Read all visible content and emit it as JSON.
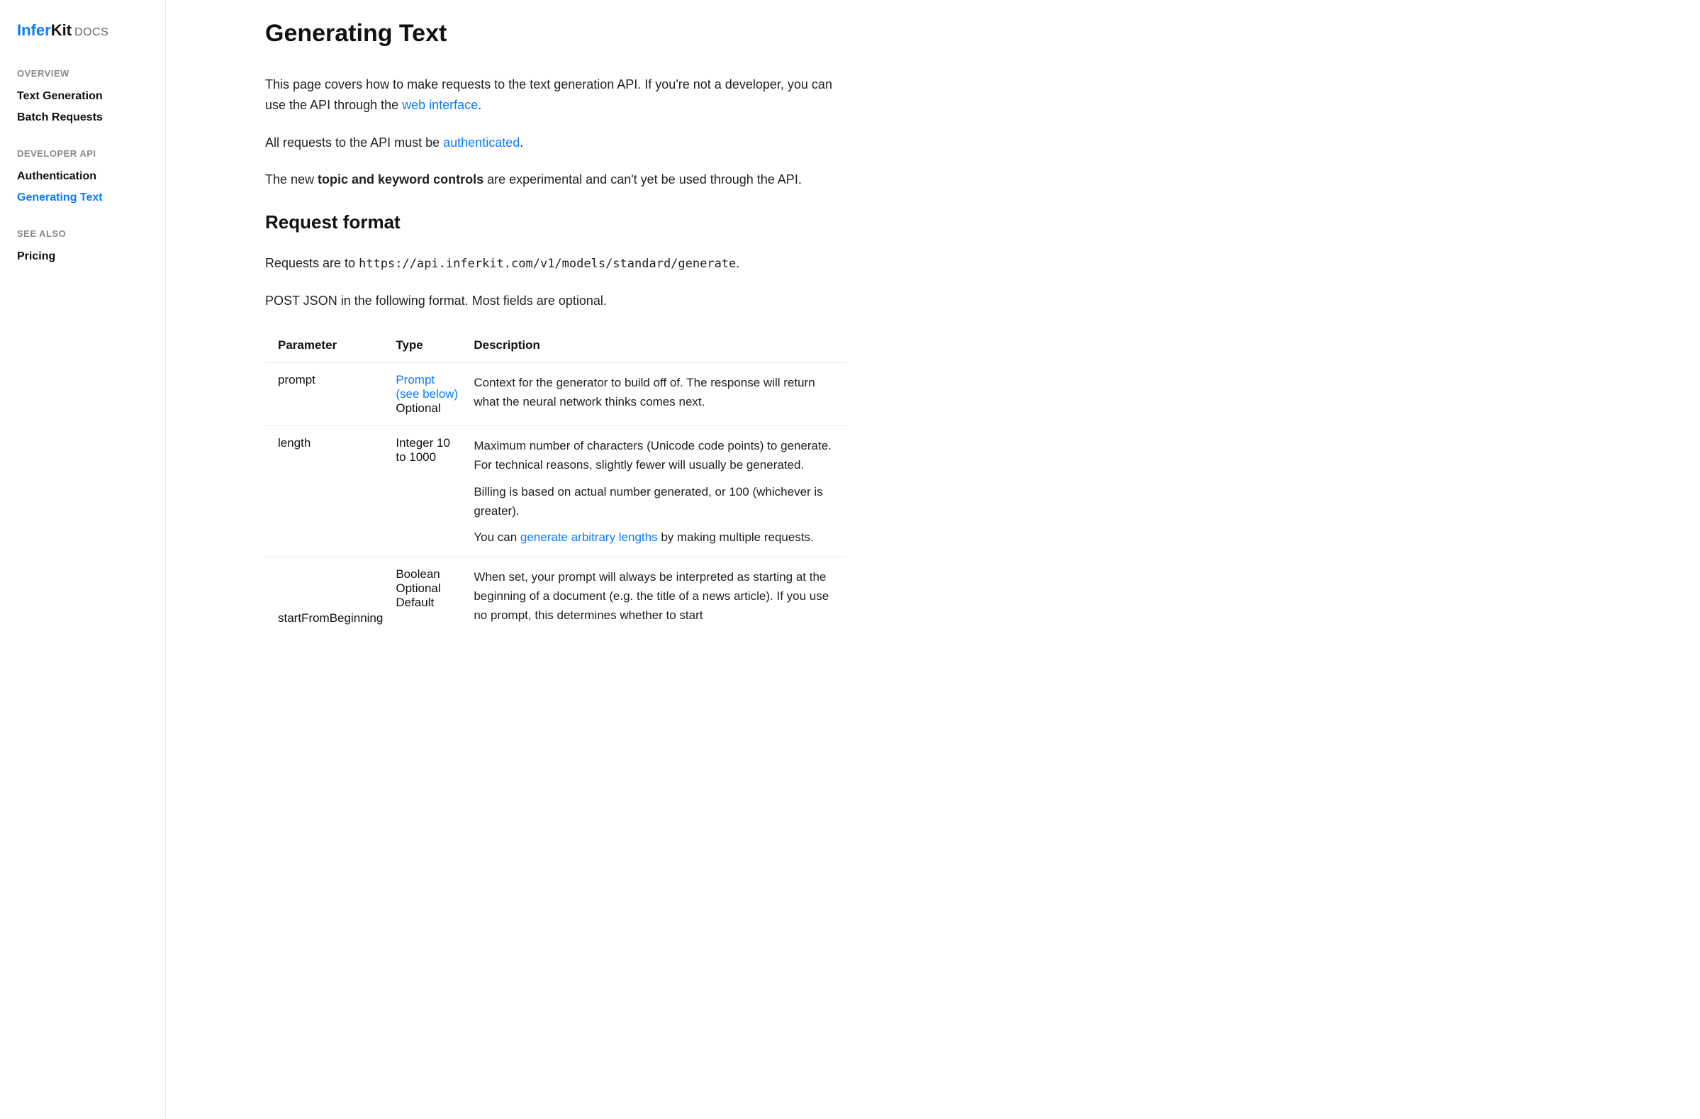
{
  "logo": {
    "part1": "Infer",
    "part2": "Kit",
    "suffix": "DOCS"
  },
  "sidebar": {
    "sections": [
      {
        "header": "OVERVIEW",
        "items": [
          {
            "label": "Text Generation",
            "active": false
          },
          {
            "label": "Batch Requests",
            "active": false
          }
        ]
      },
      {
        "header": "DEVELOPER API",
        "items": [
          {
            "label": "Authentication",
            "active": false
          },
          {
            "label": "Generating Text",
            "active": true
          }
        ]
      },
      {
        "header": "SEE ALSO",
        "items": [
          {
            "label": "Pricing",
            "active": false
          }
        ]
      }
    ]
  },
  "content": {
    "title": "Generating Text",
    "intro1_a": "This page covers how to make requests to the text generation API. If you're not a developer, you can use the API through the ",
    "intro1_link": "web interface",
    "intro1_b": ".",
    "intro2_a": "All requests to the API must be ",
    "intro2_link": "authenticated",
    "intro2_b": ".",
    "intro3_a": "The new ",
    "intro3_strong": "topic and keyword controls",
    "intro3_b": " are experimental and can't yet be used through the API.",
    "h2_request_format": "Request format",
    "requests_to_a": "Requests are to ",
    "requests_to_code": "https://api.inferkit.com/v1/models/standard/generate",
    "requests_to_b": ".",
    "post_json": "POST JSON in the following format. Most fields are optional.",
    "table": {
      "headers": {
        "param": "Parameter",
        "type": "Type",
        "desc": "Description"
      },
      "rows": [
        {
          "param": "prompt",
          "type_link": "Prompt (see below)",
          "type_extra": "Optional",
          "desc_parts": [
            "Context for the generator to build off of. The response will return what the neural network thinks comes next."
          ]
        },
        {
          "param": "length",
          "type_plain": "Integer 10 to 1000",
          "desc_parts": [
            "Maximum number of characters (Unicode code points) to generate. For technical reasons, slightly fewer will usually be generated.",
            "Billing is based on actual number generated, or 100 (whichever is greater)."
          ],
          "desc_p3_a": "You can ",
          "desc_p3_link": "generate arbitrary lengths",
          "desc_p3_b": " by making multiple requests."
        },
        {
          "param": "startFromBeginning",
          "type_plain": "Boolean Optional Default",
          "desc_parts": [
            "When set, your prompt will always be interpreted as starting at the beginning of a document (e.g. the title of a news article). If you use no prompt, this determines whether to start"
          ]
        }
      ]
    }
  }
}
